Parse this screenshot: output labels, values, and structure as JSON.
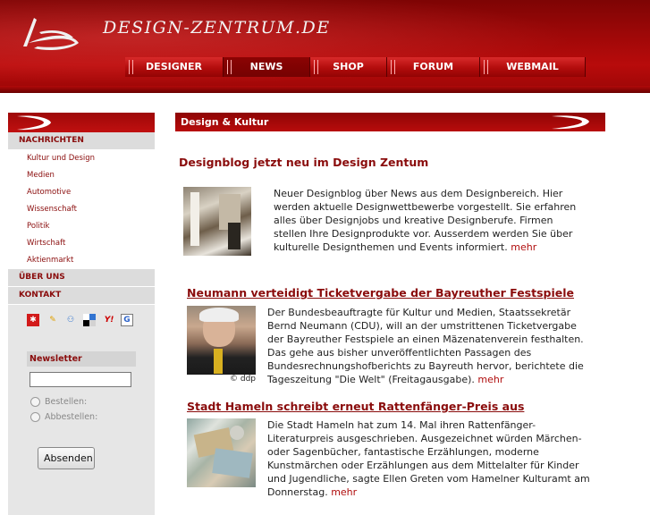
{
  "site": {
    "title": "DESIGN-ZENTRUM.DE"
  },
  "nav": {
    "items": [
      {
        "label": "DESIGNER"
      },
      {
        "label": "NEWS"
      },
      {
        "label": "SHOP"
      },
      {
        "label": "FORUM"
      },
      {
        "label": "WEBMAIL"
      }
    ],
    "active_index": 1
  },
  "sidebar": {
    "sections": [
      {
        "label": "NACHRICHTEN"
      },
      {
        "label": "ÜBER UNS"
      },
      {
        "label": "KONTAKT"
      }
    ],
    "subitems": [
      {
        "label": "Kultur und Design"
      },
      {
        "label": "Medien"
      },
      {
        "label": "Automotive"
      },
      {
        "label": "Wissenschaft"
      },
      {
        "label": "Politik"
      },
      {
        "label": "Wirtschaft"
      },
      {
        "label": "Aktienmarkt"
      }
    ],
    "social_icons": [
      "mrwong-icon",
      "webnews-icon",
      "linkarena-icon",
      "delicious-icon",
      "yahoo-icon",
      "google-icon"
    ],
    "newsletter": {
      "title": "Newsletter",
      "input_value": "",
      "options": [
        "Bestellen:",
        "Abbestellen:"
      ],
      "submit_label": "Absenden"
    }
  },
  "main": {
    "section_title": "Design & Kultur",
    "feature": {
      "headline": "Designblog jetzt neu im Design Zentum",
      "text": "Neuer Designblog über News aus dem Designbereich. Hier werden aktuelle Designwettbewerbe vorgestellt. Sie erfahren alles über Designjobs und kreative Designberufe. Firmen stellen Ihre Designprodukte vor. Ausserdem werden Sie über kulturelle Designthemen und Events informiert.",
      "more": "mehr"
    },
    "articles": [
      {
        "headline": "Neumann verteidigt Ticketvergabe der Bayreuther Festspiele",
        "text": "Der Bundesbeauftragte für Kultur und Medien, Staatssekretär Bernd Neumann (CDU), will an der umstrittenen Ticketvergabe der Bayreuther Festspiele an einen Mäzenatenverein festhalten. Das gehe aus bisher unveröffentlichten Passagen des Bundesrechnungshofberichts zu Bayreuth hervor, berichtete die Tageszeitung \"Die Welt\" (Freitagausgabe).",
        "more": "mehr",
        "photo_credit": "© ddp"
      },
      {
        "headline": "Stadt Hameln schreibt erneut Rattenfänger-Preis aus",
        "text": "Die Stadt Hameln hat zum 14. Mal ihren Rattenfänger-Literaturpreis ausgeschrieben. Ausgezeichnet würden Märchen- oder Sagenbücher, fantastische Erzählungen, moderne Kunstmärchen oder Erzählungen aus dem Mittelalter für Kinder und Jugendliche, sagte Ellen Greten vom Hamelner Kulturamt am Donnerstag.",
        "more": "mehr"
      }
    ]
  },
  "colors": {
    "brand_red": "#a00808",
    "link_red": "#8a0c0c",
    "panel_gray": "#e6e6e6"
  }
}
